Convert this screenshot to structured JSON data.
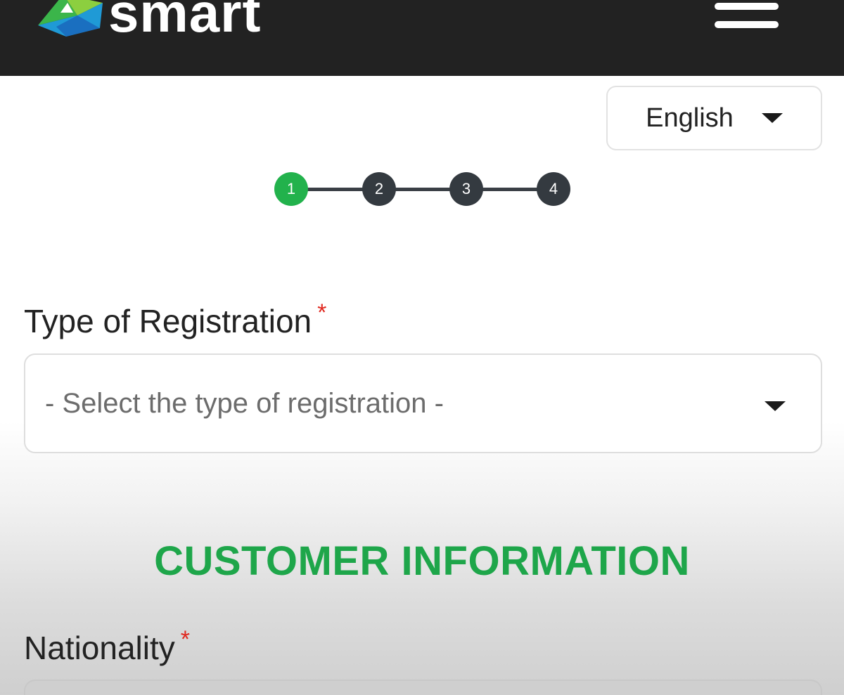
{
  "header": {
    "logo_text": "smart",
    "background": "#222222"
  },
  "language": {
    "selected": "English",
    "icon": "caret-down-icon"
  },
  "stepper": {
    "steps": [
      "1",
      "2",
      "3",
      "4"
    ],
    "current_step": 1,
    "active_color": "#22b24c",
    "inactive_color": "#343a40"
  },
  "registration": {
    "label": "Type of Registration",
    "required_mark": "*",
    "placeholder": "- Select the type of registration -"
  },
  "customer_info": {
    "title": "CUSTOMER INFORMATION",
    "title_color": "#1ea64a"
  },
  "nationality": {
    "label": "Nationality",
    "required_mark": "*"
  },
  "colors": {
    "required": "#e0281f"
  }
}
